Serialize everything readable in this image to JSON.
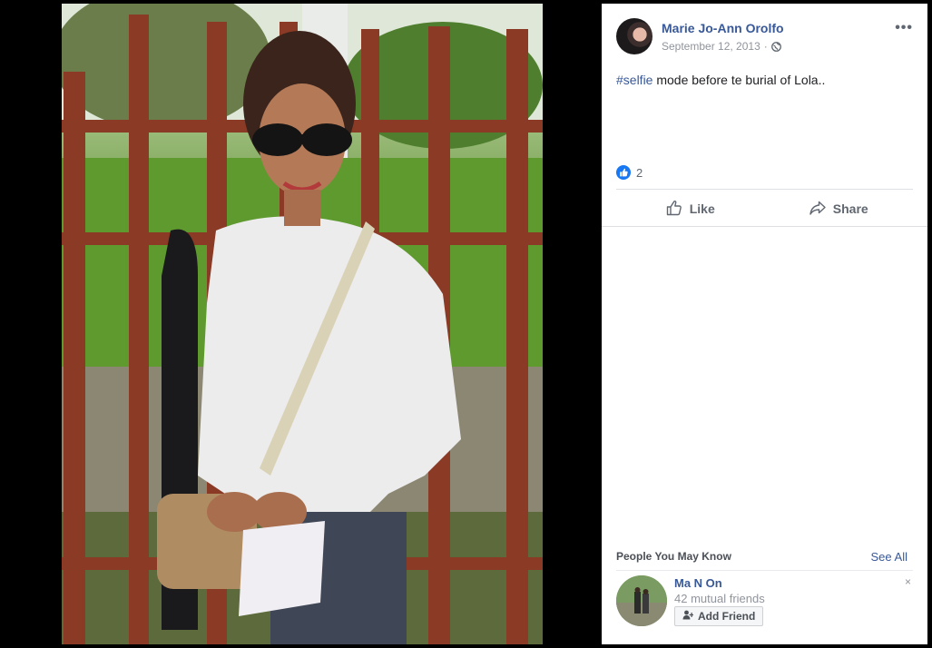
{
  "post": {
    "author": "Marie Jo-Ann Orolfo",
    "date": "September 12, 2013",
    "separator": "·",
    "privacy_icon": "globe-icon",
    "more_icon": "more-options-icon",
    "hashtag": "#selfie",
    "caption_rest": " mode before te burial of Lola..",
    "reaction_count": "2"
  },
  "actions": {
    "like_label": "Like",
    "share_label": "Share"
  },
  "pymk": {
    "title": "People You May Know",
    "see_all": "See All",
    "dismiss": "×",
    "suggestion": {
      "name": "Ma N On",
      "mutual": "42 mutual friends",
      "add_label": "Add Friend"
    }
  },
  "colors": {
    "link": "#385898",
    "reaction_blue": "#1877f2",
    "meta_gray": "#90949c"
  }
}
